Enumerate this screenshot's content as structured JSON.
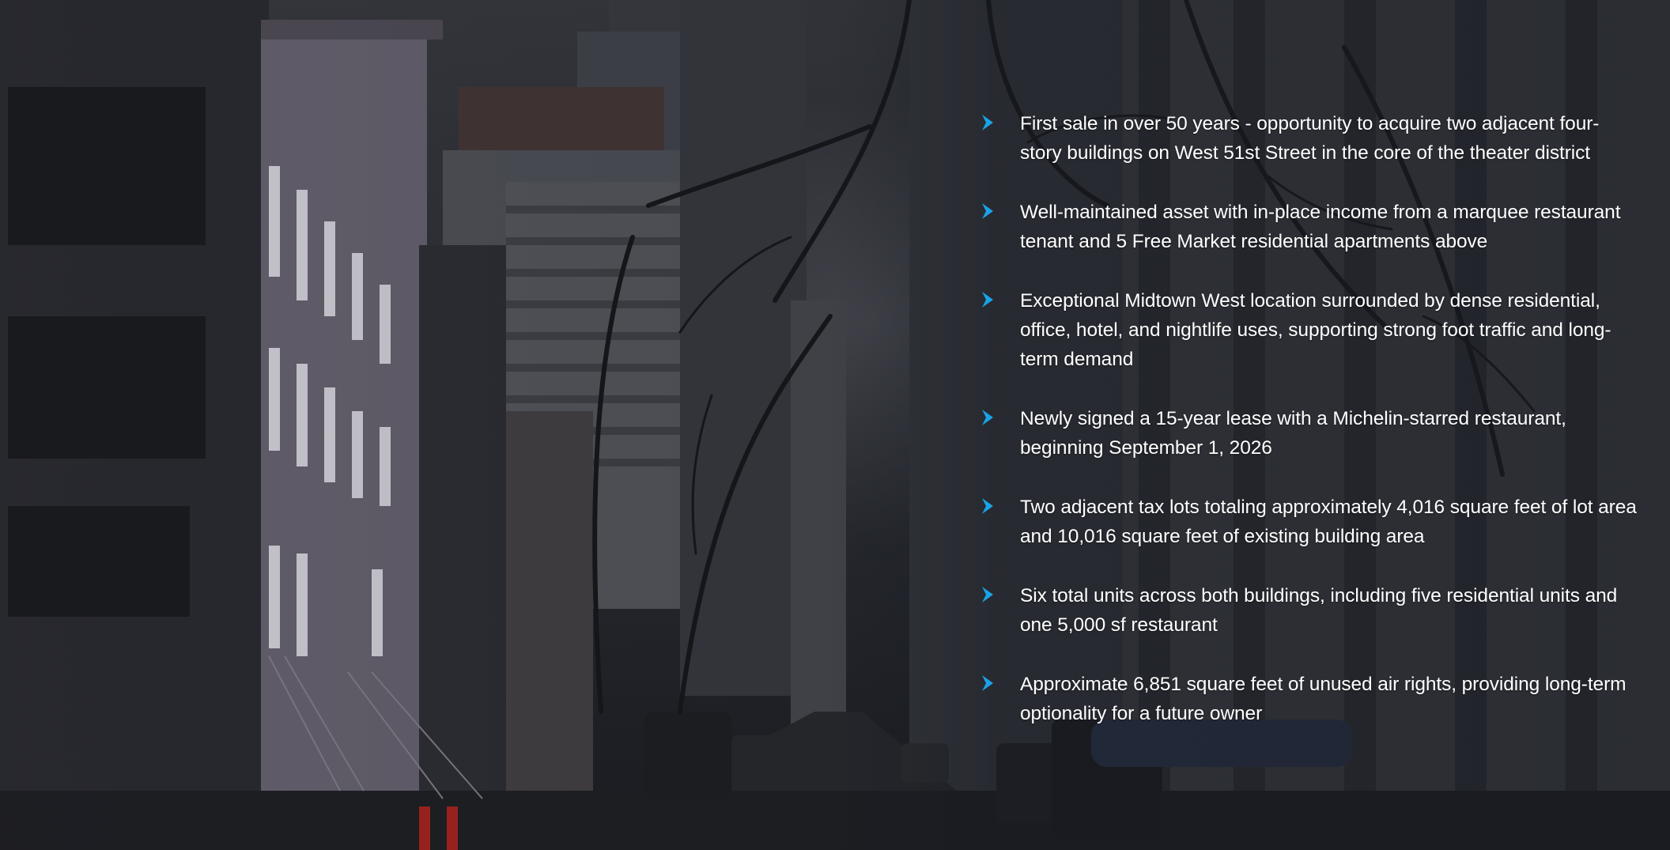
{
  "background": {
    "scene": "city-street-photo",
    "accent_color": "#1aa3e8"
  },
  "highlights": {
    "icon": "chevron-right-icon",
    "items": [
      {
        "text": "First sale in over 50 years - opportunity to acquire two adjacent four-story buildings on West 51st Street in the core of the theater district"
      },
      {
        "text": "Well-maintained asset with in-place income from a marquee restaurant tenant and 5 Free Market residential apartments above"
      },
      {
        "text": "Exceptional Midtown West location surrounded by dense residential, office, hotel, and nightlife uses, supporting strong foot traffic and long-term demand"
      },
      {
        "text": "Newly signed a 15-year lease with a Michelin-starred restaurant, beginning September 1, 2026"
      },
      {
        "text": "Two adjacent tax lots totaling approximately 4,016 square feet of lot area and 10,016 square feet of existing building area"
      },
      {
        "text": "Six total units across both buildings, including five residential units and one 5,000 sf restaurant"
      },
      {
        "text": "Approximate 6,851 square feet of unused air rights, providing long-term optionality for a future owner"
      }
    ]
  }
}
